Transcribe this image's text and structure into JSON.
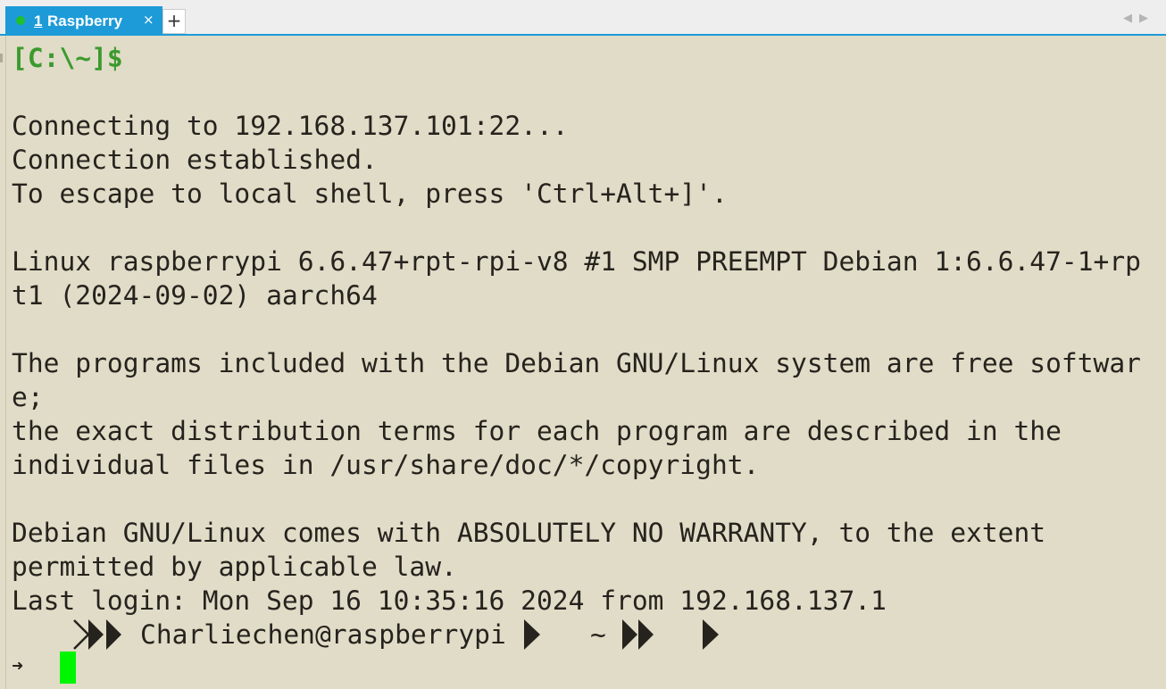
{
  "tab": {
    "number": "1",
    "label": "Raspberry",
    "close_glyph": "×",
    "status_color": "#1fbf2f",
    "active_color": "#1d9bd8"
  },
  "new_tab_glyph": "+",
  "scroll_arrows": "◀▶",
  "terminal": {
    "local_prompt": "[C:\\~]$",
    "lines": [
      "Connecting to 192.168.137.101:22...",
      "Connection established.",
      "To escape to local shell, press 'Ctrl+Alt+]'.",
      "",
      "Linux raspberrypi 6.6.47+rpt-rpi-v8 #1 SMP PREEMPT Debian 1:6.6.47-1+rp",
      "t1 (2024-09-02) aarch64",
      "",
      "The programs included with the Debian GNU/Linux system are free softwar",
      "e;",
      "the exact distribution terms for each program are described in the",
      "individual files in /usr/share/doc/*/copyright.",
      "",
      "Debian GNU/Linux comes with ABSOLUTELY NO WARRANTY, to the extent",
      "permitted by applicable law.",
      "Last login: Mon Sep 16 10:35:16 2024 from 192.168.137.1"
    ],
    "powerline": {
      "user_host": "Charliechen@raspberrypi",
      "cwd": "~"
    },
    "input_arrow": "➜",
    "cursor_color": "#00f500"
  }
}
